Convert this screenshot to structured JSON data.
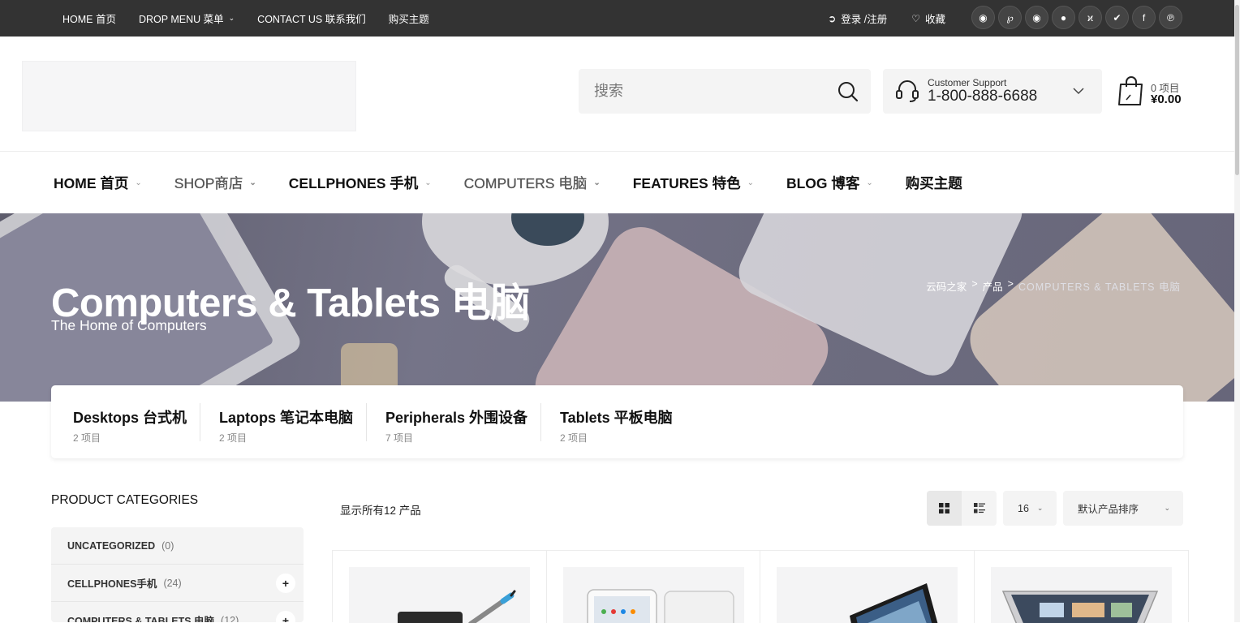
{
  "topbar": {
    "nav": [
      {
        "label": "HOME 首页",
        "has_menu": false
      },
      {
        "label": "DROP MENU 菜单",
        "has_menu": true
      },
      {
        "label": "CONTACT US 联系我们",
        "has_menu": false
      },
      {
        "label": "购买主题",
        "has_menu": false
      }
    ],
    "login_label": "登录 /注册",
    "wishlist_label": "收藏",
    "socials": [
      "weibo-icon",
      "pinterest-p-icon",
      "wechat-icon",
      "qq-icon",
      "renren-icon",
      "twitter-icon",
      "facebook-icon",
      "pinterest-icon"
    ]
  },
  "header": {
    "search": {
      "placeholder": "搜索"
    },
    "support": {
      "label": "Customer Support",
      "phone": "1-800-888-6688"
    },
    "cart": {
      "count": "0 项目",
      "total": "¥0.00"
    }
  },
  "mainnav": [
    {
      "label": "HOME 首页",
      "style": "bold"
    },
    {
      "label": "SHOP商店",
      "style": "light"
    },
    {
      "label": "CELLPHONES 手机",
      "style": "bold"
    },
    {
      "label": "COMPUTERS 电脑",
      "style": "light"
    },
    {
      "label": "FEATURES 特色",
      "style": "bold"
    },
    {
      "label": "BLOG 博客",
      "style": "bold"
    },
    {
      "label": "购买主题",
      "style": "bold"
    }
  ],
  "banner": {
    "title": "Computers & Tablets 电脑",
    "subtitle": "The Home of Computers",
    "breadcrumb": [
      "云码之家",
      "产品",
      "COMPUTERS & TABLETS 电脑"
    ]
  },
  "subcategories": [
    {
      "name": "Desktops 台式机",
      "count": "2 项目"
    },
    {
      "name": "Laptops 笔记本电脑",
      "count": "2 项目"
    },
    {
      "name": "Peripherals 外围设备",
      "count": "7 项目"
    },
    {
      "name": "Tablets 平板电脑",
      "count": "2 项目"
    }
  ],
  "sidebar": {
    "title": "PRODUCT CATEGORIES",
    "items": [
      {
        "name": "UNCATEGORIZED",
        "count": "(0)"
      },
      {
        "name": "CELLPHONES手机",
        "count": "(24)"
      },
      {
        "name": "COMPUTERS & TABLETS 电脑",
        "count": "(12)"
      }
    ]
  },
  "toolbar": {
    "result_text": "显示所有12 产品",
    "per_page": "16",
    "sort": "默认产品排序"
  },
  "products": [
    {
      "image": "stylus-pen-product"
    },
    {
      "image": "ipad-tablets-product"
    },
    {
      "image": "imac-desktop-product"
    },
    {
      "image": "macbook-laptop-product"
    }
  ],
  "colors": {
    "topbar": "#333333",
    "accent": "#111111",
    "panel": "#f4f4f4"
  }
}
